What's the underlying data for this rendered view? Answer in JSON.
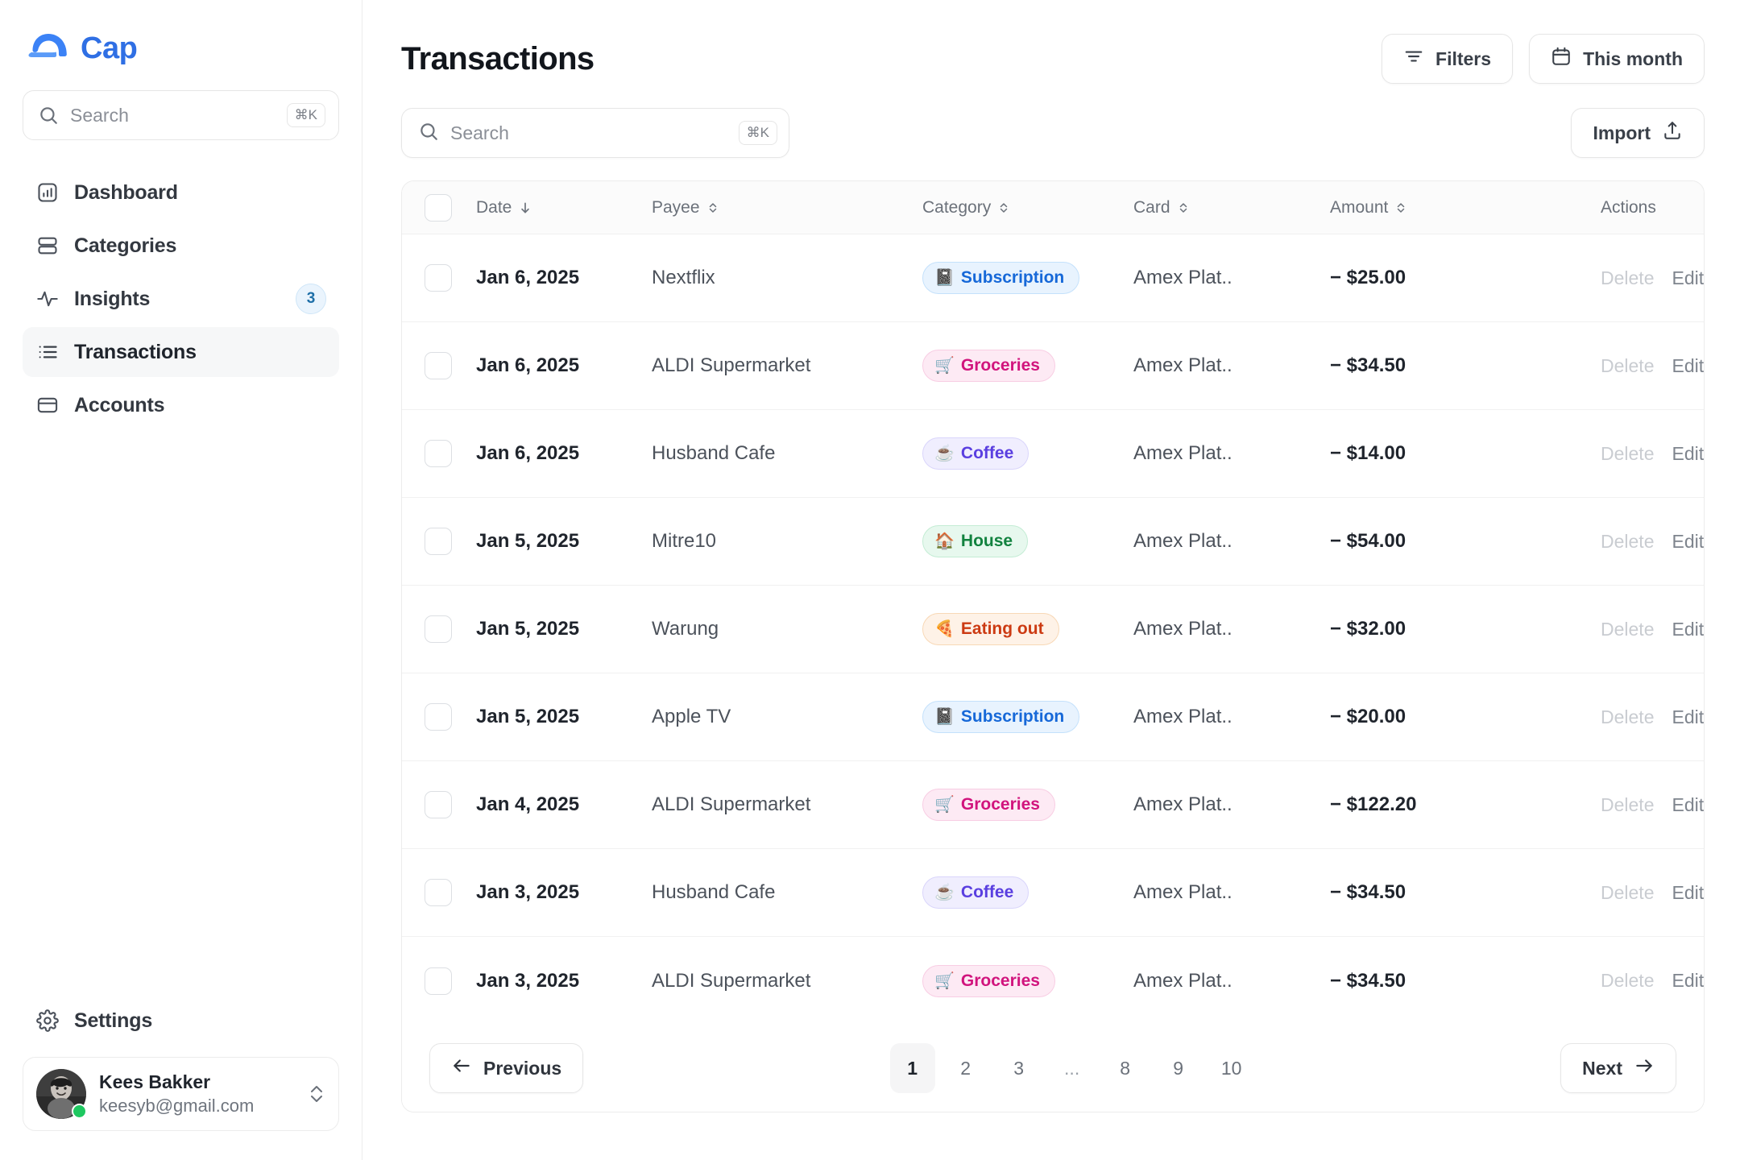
{
  "sidebar": {
    "brand": {
      "name": "Cap",
      "logo_icon": "cap-logo-icon"
    },
    "search": {
      "placeholder": "Search",
      "shortcut": "⌘K",
      "icon": "search-icon"
    },
    "items": [
      {
        "label": "Dashboard",
        "icon": "chart-square-icon",
        "active": false,
        "badge": ""
      },
      {
        "label": "Categories",
        "icon": "rows-icon",
        "active": false,
        "badge": ""
      },
      {
        "label": "Insights",
        "icon": "activity-icon",
        "active": false,
        "badge": "3"
      },
      {
        "label": "Transactions",
        "icon": "list-icon",
        "active": true,
        "badge": ""
      },
      {
        "label": "Accounts",
        "icon": "credit-card-icon",
        "active": false,
        "badge": ""
      }
    ],
    "settings": {
      "label": "Settings",
      "icon": "gear-icon"
    },
    "profile": {
      "name": "Kees Bakker",
      "email": "keesyb@gmail.com",
      "status": "online",
      "chevron_icon": "chevron-up-down-icon"
    }
  },
  "header": {
    "title": "Transactions",
    "filters_label": "Filters",
    "filters_icon": "filter-icon",
    "date_range_label": "This month",
    "date_range_icon": "calendar-icon"
  },
  "toolbar": {
    "search_placeholder": "Search",
    "search_shortcut": "⌘K",
    "search_icon": "search-icon",
    "import_label": "Import",
    "import_icon": "upload-icon"
  },
  "table": {
    "columns": [
      {
        "key": "date",
        "label": "Date",
        "sort_icon": "arrow-down-icon"
      },
      {
        "key": "payee",
        "label": "Payee",
        "sort_icon": "sort-icon"
      },
      {
        "key": "category",
        "label": "Category",
        "sort_icon": "sort-icon"
      },
      {
        "key": "card",
        "label": "Card",
        "sort_icon": "sort-icon"
      },
      {
        "key": "amount",
        "label": "Amount",
        "sort_icon": "sort-icon"
      },
      {
        "key": "actions",
        "label": "Actions",
        "sort_icon": ""
      }
    ],
    "row_actions": {
      "delete_label": "Delete",
      "edit_label": "Edit"
    },
    "category_styles": {
      "Subscription": {
        "bg": "#e8f3fe",
        "border": "#c4e1fb",
        "fg": "#1668d8",
        "emoji": "📓"
      },
      "Groceries": {
        "bg": "#fdeaf4",
        "border": "#f8cde3",
        "fg": "#d1147d",
        "emoji": "🛒"
      },
      "Coffee": {
        "bg": "#f0eefe",
        "border": "#d9d5fb",
        "fg": "#5a3fe0",
        "emoji": "☕"
      },
      "House": {
        "bg": "#e7f8ee",
        "border": "#c3ecd4",
        "fg": "#12823f",
        "emoji": "🏠"
      },
      "Eating out": {
        "bg": "#fef2e7",
        "border": "#f8d8b6",
        "fg": "#cc3a12",
        "emoji": "🍕"
      }
    },
    "rows": [
      {
        "date": "Jan 6, 2025",
        "payee": "Nextflix",
        "category": "Subscription",
        "card": "Amex Plat..",
        "amount": "− $25.00"
      },
      {
        "date": "Jan 6, 2025",
        "payee": "ALDI Supermarket",
        "category": "Groceries",
        "card": "Amex Plat..",
        "amount": "− $34.50"
      },
      {
        "date": "Jan 6, 2025",
        "payee": "Husband Cafe",
        "category": "Coffee",
        "card": "Amex Plat..",
        "amount": "− $14.00"
      },
      {
        "date": "Jan 5, 2025",
        "payee": "Mitre10",
        "category": "House",
        "card": "Amex Plat..",
        "amount": "− $54.00"
      },
      {
        "date": "Jan 5, 2025",
        "payee": "Warung",
        "category": "Eating out",
        "card": "Amex Plat..",
        "amount": "− $32.00"
      },
      {
        "date": "Jan 5, 2025",
        "payee": "Apple TV",
        "category": "Subscription",
        "card": "Amex Plat..",
        "amount": "− $20.00"
      },
      {
        "date": "Jan 4, 2025",
        "payee": "ALDI Supermarket",
        "category": "Groceries",
        "card": "Amex Plat..",
        "amount": "− $122.20"
      },
      {
        "date": "Jan 3, 2025",
        "payee": "Husband Cafe",
        "category": "Coffee",
        "card": "Amex Plat..",
        "amount": "− $34.50"
      },
      {
        "date": "Jan 3, 2025",
        "payee": "ALDI Supermarket",
        "category": "Groceries",
        "card": "Amex Plat..",
        "amount": "− $34.50"
      }
    ]
  },
  "pagination": {
    "previous_label": "Previous",
    "next_label": "Next",
    "pages": [
      "1",
      "2",
      "3",
      "...",
      "8",
      "9",
      "10"
    ],
    "current": "1"
  },
  "colors": {
    "accent": "#2f6fe4",
    "online": "#1ec860",
    "text": "#1f242c",
    "muted": "#6b717a"
  }
}
